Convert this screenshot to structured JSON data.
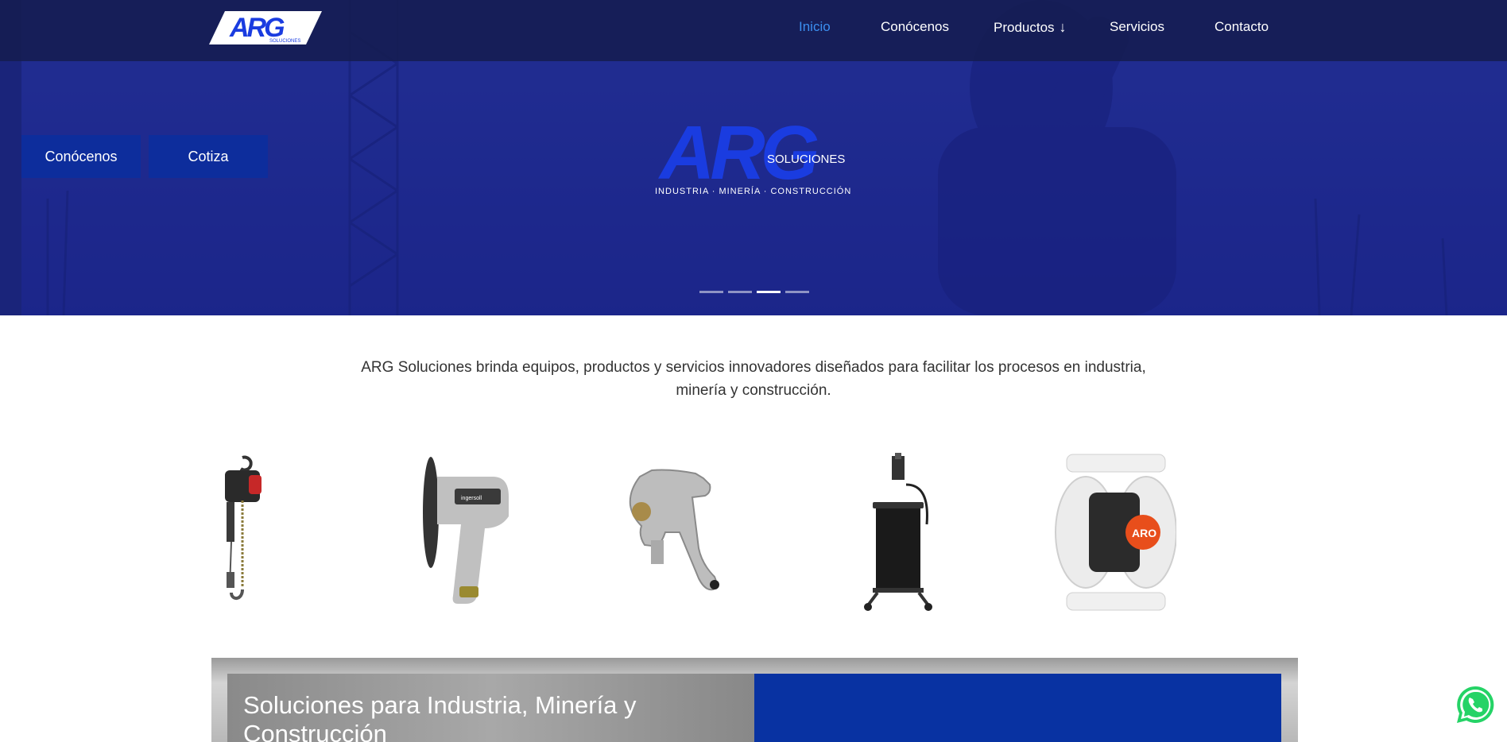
{
  "nav": {
    "items": [
      {
        "label": "Inicio",
        "active": true
      },
      {
        "label": "Conócenos",
        "active": false
      },
      {
        "label": "Productos",
        "active": false
      },
      {
        "label": "Servicios",
        "active": false
      },
      {
        "label": "Contacto",
        "active": false
      }
    ]
  },
  "logo": {
    "text": "ARG",
    "subtext": "SOLUCIONES"
  },
  "hero": {
    "buttons": [
      "Conócenos",
      "Cotiza"
    ],
    "logo_text": "ARG",
    "logo_sub": "SOLUCIONES",
    "tagline": "INDUSTRIA · MINERÍA · CONSTRUCCIÓN",
    "slides_total": 4,
    "active_slide": 3
  },
  "intro": {
    "text": "ARG Soluciones brinda equipos, productos y servicios innovadores diseñados para facilitar los procesos en industria, minería y construcción."
  },
  "products": [
    {
      "icon": "air-hoist-icon"
    },
    {
      "icon": "angle-grinder-icon"
    },
    {
      "icon": "spray-gun-icon"
    },
    {
      "icon": "grease-pump-icon"
    },
    {
      "icon": "diaphragm-pump-icon",
      "badge": "ARO"
    }
  ],
  "banner": {
    "title": "Soluciones para Industria, Minería y Construcción"
  },
  "colors": {
    "accent": "#3b8ff0",
    "brand_blue": "#0d2d9c",
    "banner_blue": "#0832a2",
    "whatsapp": "#25d366"
  }
}
